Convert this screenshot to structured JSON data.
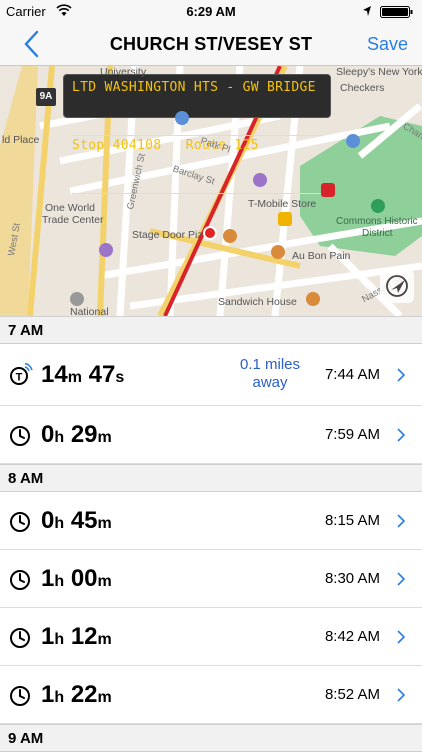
{
  "status_bar": {
    "carrier": "Carrier",
    "time": "6:29 AM"
  },
  "nav": {
    "title": "CHURCH ST/VESEY ST",
    "save_label": "Save"
  },
  "map": {
    "led_line1": "LTD WASHINGTON HTS - GW BRIDGE",
    "led_line2": "Stop 404108   Route 125",
    "shield": "9A",
    "labels": {
      "university": "University",
      "sleepys": "Sleepy's New York",
      "checkers": "Checkers",
      "old_place": "ld Place",
      "park_pl": "Park Pl",
      "barclay": "Barclay St",
      "greenwich": "Greenwich St",
      "one_wtc_1": "One World",
      "one_wtc_2": "Trade Center",
      "tmobile": "T-Mobile Store",
      "commons_1": "Commons Historic",
      "commons_2": "District",
      "stage_door": "Stage Door Piz",
      "au_bon_pain": "Au Bon Pain",
      "sandwich": "Sandwich House",
      "west_st": "West St",
      "national": "National",
      "nassau": "Nassau St",
      "chambers": "Chan"
    }
  },
  "sections": [
    {
      "header": "7 AM",
      "rows": [
        {
          "icon": "transit-realtime-icon",
          "h": "14",
          "hu": "m",
          "m": "47",
          "mu": "s",
          "dist1": "0.1 miles",
          "dist2": "away",
          "time": "7:44 AM"
        },
        {
          "icon": "clock-icon",
          "h": "0",
          "hu": "h",
          "m": "29",
          "mu": "m",
          "time": "7:59 AM"
        }
      ]
    },
    {
      "header": "8 AM",
      "rows": [
        {
          "icon": "clock-icon",
          "h": "0",
          "hu": "h",
          "m": "45",
          "mu": "m",
          "time": "8:15 AM"
        },
        {
          "icon": "clock-icon",
          "h": "1",
          "hu": "h",
          "m": "00",
          "mu": "m",
          "time": "8:30 AM"
        },
        {
          "icon": "clock-icon",
          "h": "1",
          "hu": "h",
          "m": "12",
          "mu": "m",
          "time": "8:42 AM"
        },
        {
          "icon": "clock-icon",
          "h": "1",
          "hu": "h",
          "m": "22",
          "mu": "m",
          "time": "8:52 AM"
        }
      ]
    },
    {
      "header": "9 AM",
      "rows": []
    }
  ],
  "colors": {
    "accent": "#2a7de1",
    "distance": "#2a5fc8",
    "route_line": "#d8232a",
    "park": "#8fd09a"
  }
}
